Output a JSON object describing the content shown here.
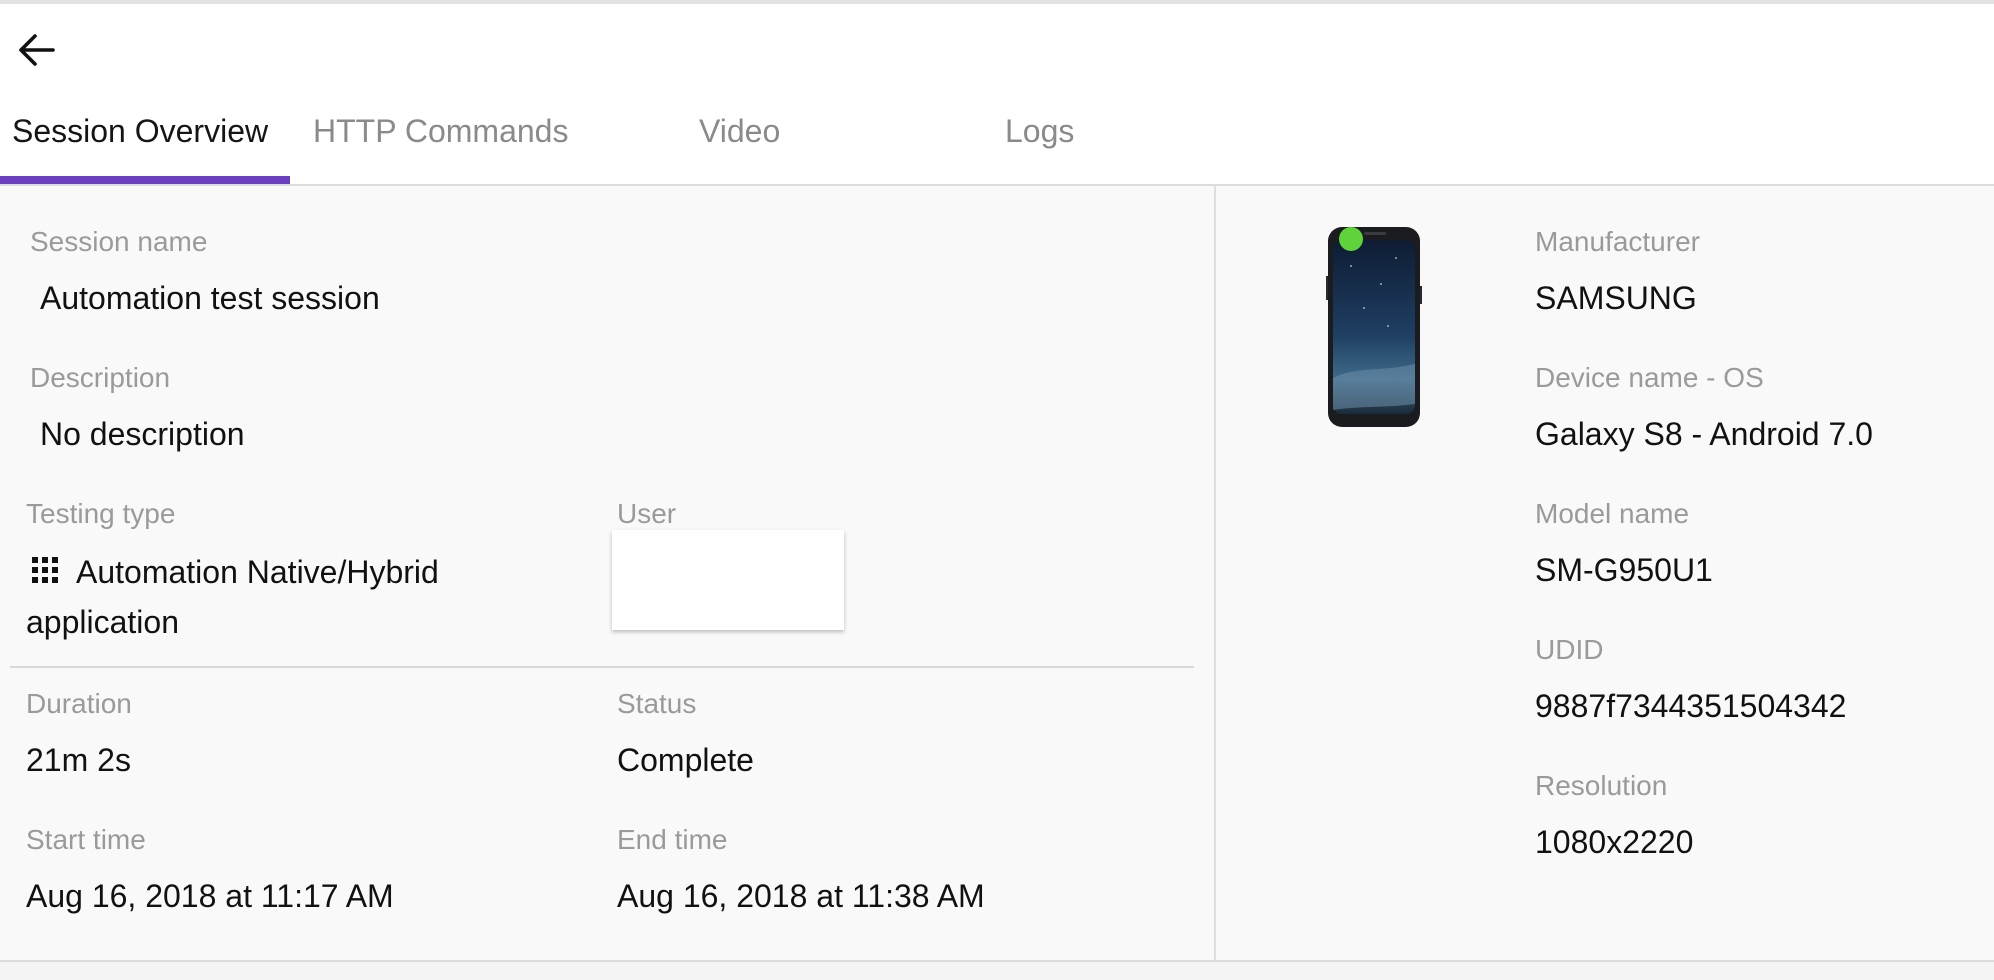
{
  "header": {
    "back_icon": "arrow-left-icon"
  },
  "tabs": [
    {
      "label": "Session Overview",
      "active": true
    },
    {
      "label": "HTTP Commands",
      "active": false
    },
    {
      "label": "Video",
      "active": false
    },
    {
      "label": "Logs",
      "active": false
    }
  ],
  "accent_color": "#6a3fbf",
  "session": {
    "name_label": "Session name",
    "name": "Automation test session",
    "description_label": "Description",
    "description": "No description",
    "testing_type_label": "Testing type",
    "testing_type_line1": "Automation Native/Hybrid",
    "testing_type_line2": "application",
    "testing_type_icon": "apps-grid-icon",
    "user_label": "User",
    "duration_label": "Duration",
    "duration": "21m 2s",
    "status_label": "Status",
    "status": "Complete",
    "start_label": "Start time",
    "start": "Aug 16, 2018 at 11:17 AM",
    "end_label": "End time",
    "end": "Aug 16, 2018 at 11:38 AM"
  },
  "device": {
    "image": "phone-device-image",
    "online_indicator_color": "#5fd43a",
    "manufacturer_label": "Manufacturer",
    "manufacturer": "SAMSUNG",
    "name_os_label": "Device name - OS",
    "name_os": "Galaxy S8 - Android 7.0",
    "model_label": "Model name",
    "model": "SM-G950U1",
    "udid_label": "UDID",
    "udid": "9887f7344351504342",
    "resolution_label": "Resolution",
    "resolution": "1080x2220"
  }
}
